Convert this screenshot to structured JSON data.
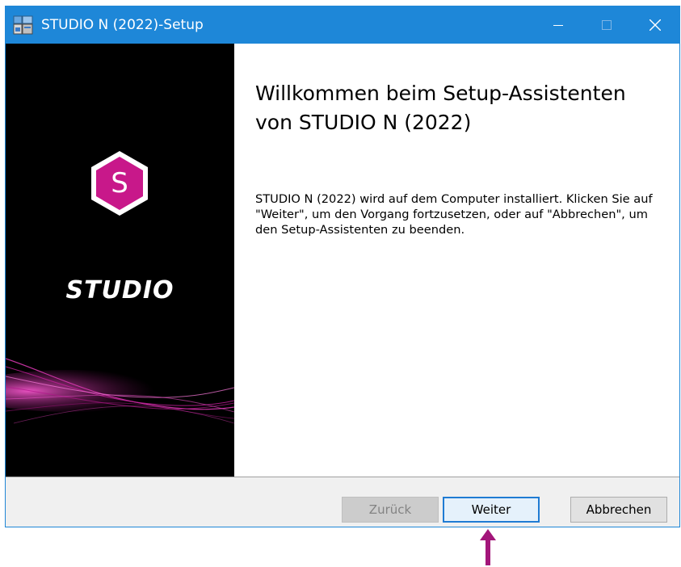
{
  "window": {
    "title": "STUDIO N (2022)-Setup"
  },
  "titlebar": {
    "minimize_icon": "minimize-icon",
    "maximize_icon": "maximize-icon",
    "close_icon": "close-icon",
    "accent_color": "#1e87d8"
  },
  "sidebar": {
    "logo_letter": "S",
    "logo_color": "#c8188a",
    "brand_text": "STUDIO"
  },
  "content": {
    "title": "Willkommen beim Setup-Assistenten von STUDIO N (2022)",
    "body": "STUDIO N (2022) wird auf dem Computer installiert. Klicken Sie auf \"Weiter\", um den Vorgang fortzusetzen, oder auf \"Abbrechen\", um den Setup-Assistenten zu beenden."
  },
  "footer": {
    "back_label": "Zurück",
    "next_label": "Weiter",
    "cancel_label": "Abbrechen"
  },
  "annotation": {
    "arrow_color": "#a3167a",
    "icon": "arrow-up-icon"
  }
}
